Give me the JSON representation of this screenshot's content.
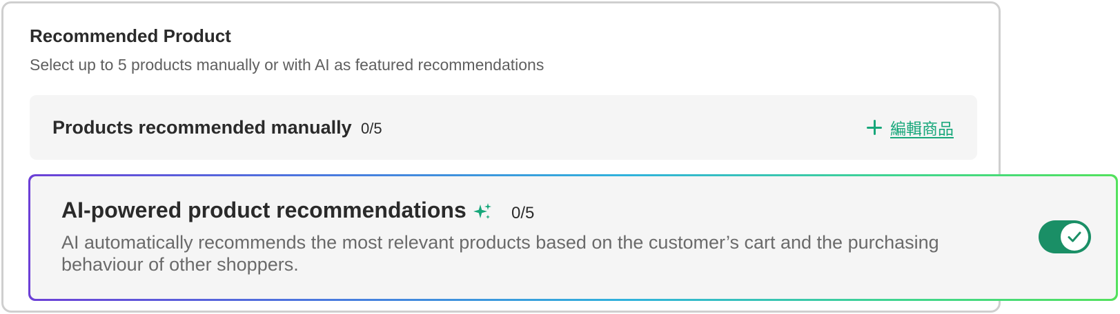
{
  "recommended": {
    "title": "Recommended Product",
    "subtitle": "Select up to 5 products manually or with AI as featured recommendations"
  },
  "manual": {
    "title": "Products recommended manually",
    "count": "0/5",
    "edit_label": "編輯商品",
    "edit_icon": "plus-icon"
  },
  "ai": {
    "title": "AI-powered product recommendations",
    "title_icon": "sparkle-icon",
    "count": "0/5",
    "description": "AI automatically recommends the most relevant products based on the customer’s cart and the purchasing behaviour of other shoppers.",
    "toggle_on": true
  },
  "colors": {
    "accent": "#17a77a",
    "toggle_on": "#1a8f66",
    "panel_bg": "#f5f5f5",
    "card_border": "#cfcfcf",
    "gradient_start": "#6c3fd6",
    "gradient_end": "#52e15c"
  }
}
